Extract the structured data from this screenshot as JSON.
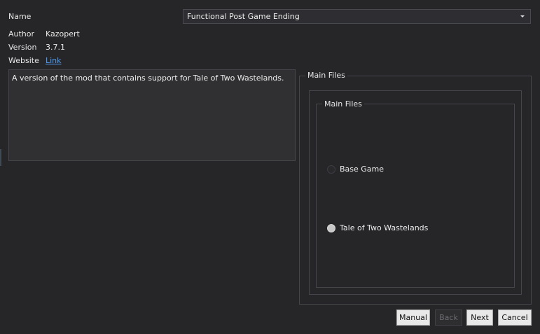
{
  "fields": {
    "name_label": "Name",
    "author_label": "Author",
    "author_value": "Kazopert",
    "version_label": "Version",
    "version_value": "3.7.1",
    "website_label": "Website",
    "website_link": "Link"
  },
  "name_select": {
    "value": "Functional Post Game Ending",
    "icon": "chevron-down-icon"
  },
  "description": "A version of the mod that contains support for Tale of Two Wastelands.",
  "groups": {
    "outer_title": "Main Files",
    "inner_title": "Main Files",
    "options": [
      {
        "label": "Base Game",
        "selected": false
      },
      {
        "label": "Tale of Two Wastelands",
        "selected": true
      }
    ]
  },
  "buttons": {
    "manual": "Manual",
    "back": "Back",
    "next": "Next",
    "cancel": "Cancel"
  },
  "colors": {
    "background": "#262629",
    "link": "#4f9ef4",
    "border": "#45454b"
  }
}
